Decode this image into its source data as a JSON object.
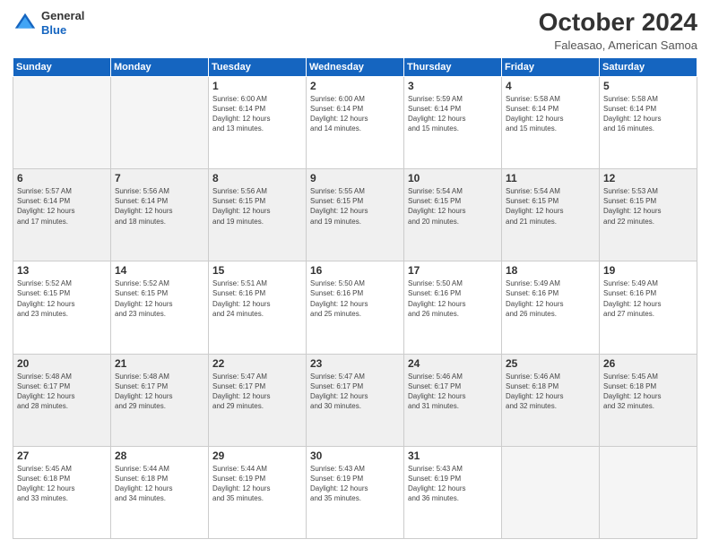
{
  "logo": {
    "general": "General",
    "blue": "Blue"
  },
  "header": {
    "title": "October 2024",
    "subtitle": "Faleasao, American Samoa"
  },
  "days_of_week": [
    "Sunday",
    "Monday",
    "Tuesday",
    "Wednesday",
    "Thursday",
    "Friday",
    "Saturday"
  ],
  "weeks": [
    [
      {
        "day": "",
        "info": ""
      },
      {
        "day": "",
        "info": ""
      },
      {
        "day": "1",
        "info": "Sunrise: 6:00 AM\nSunset: 6:14 PM\nDaylight: 12 hours\nand 13 minutes."
      },
      {
        "day": "2",
        "info": "Sunrise: 6:00 AM\nSunset: 6:14 PM\nDaylight: 12 hours\nand 14 minutes."
      },
      {
        "day": "3",
        "info": "Sunrise: 5:59 AM\nSunset: 6:14 PM\nDaylight: 12 hours\nand 15 minutes."
      },
      {
        "day": "4",
        "info": "Sunrise: 5:58 AM\nSunset: 6:14 PM\nDaylight: 12 hours\nand 15 minutes."
      },
      {
        "day": "5",
        "info": "Sunrise: 5:58 AM\nSunset: 6:14 PM\nDaylight: 12 hours\nand 16 minutes."
      }
    ],
    [
      {
        "day": "6",
        "info": "Sunrise: 5:57 AM\nSunset: 6:14 PM\nDaylight: 12 hours\nand 17 minutes."
      },
      {
        "day": "7",
        "info": "Sunrise: 5:56 AM\nSunset: 6:14 PM\nDaylight: 12 hours\nand 18 minutes."
      },
      {
        "day": "8",
        "info": "Sunrise: 5:56 AM\nSunset: 6:15 PM\nDaylight: 12 hours\nand 19 minutes."
      },
      {
        "day": "9",
        "info": "Sunrise: 5:55 AM\nSunset: 6:15 PM\nDaylight: 12 hours\nand 19 minutes."
      },
      {
        "day": "10",
        "info": "Sunrise: 5:54 AM\nSunset: 6:15 PM\nDaylight: 12 hours\nand 20 minutes."
      },
      {
        "day": "11",
        "info": "Sunrise: 5:54 AM\nSunset: 6:15 PM\nDaylight: 12 hours\nand 21 minutes."
      },
      {
        "day": "12",
        "info": "Sunrise: 5:53 AM\nSunset: 6:15 PM\nDaylight: 12 hours\nand 22 minutes."
      }
    ],
    [
      {
        "day": "13",
        "info": "Sunrise: 5:52 AM\nSunset: 6:15 PM\nDaylight: 12 hours\nand 23 minutes."
      },
      {
        "day": "14",
        "info": "Sunrise: 5:52 AM\nSunset: 6:15 PM\nDaylight: 12 hours\nand 23 minutes."
      },
      {
        "day": "15",
        "info": "Sunrise: 5:51 AM\nSunset: 6:16 PM\nDaylight: 12 hours\nand 24 minutes."
      },
      {
        "day": "16",
        "info": "Sunrise: 5:50 AM\nSunset: 6:16 PM\nDaylight: 12 hours\nand 25 minutes."
      },
      {
        "day": "17",
        "info": "Sunrise: 5:50 AM\nSunset: 6:16 PM\nDaylight: 12 hours\nand 26 minutes."
      },
      {
        "day": "18",
        "info": "Sunrise: 5:49 AM\nSunset: 6:16 PM\nDaylight: 12 hours\nand 26 minutes."
      },
      {
        "day": "19",
        "info": "Sunrise: 5:49 AM\nSunset: 6:16 PM\nDaylight: 12 hours\nand 27 minutes."
      }
    ],
    [
      {
        "day": "20",
        "info": "Sunrise: 5:48 AM\nSunset: 6:17 PM\nDaylight: 12 hours\nand 28 minutes."
      },
      {
        "day": "21",
        "info": "Sunrise: 5:48 AM\nSunset: 6:17 PM\nDaylight: 12 hours\nand 29 minutes."
      },
      {
        "day": "22",
        "info": "Sunrise: 5:47 AM\nSunset: 6:17 PM\nDaylight: 12 hours\nand 29 minutes."
      },
      {
        "day": "23",
        "info": "Sunrise: 5:47 AM\nSunset: 6:17 PM\nDaylight: 12 hours\nand 30 minutes."
      },
      {
        "day": "24",
        "info": "Sunrise: 5:46 AM\nSunset: 6:17 PM\nDaylight: 12 hours\nand 31 minutes."
      },
      {
        "day": "25",
        "info": "Sunrise: 5:46 AM\nSunset: 6:18 PM\nDaylight: 12 hours\nand 32 minutes."
      },
      {
        "day": "26",
        "info": "Sunrise: 5:45 AM\nSunset: 6:18 PM\nDaylight: 12 hours\nand 32 minutes."
      }
    ],
    [
      {
        "day": "27",
        "info": "Sunrise: 5:45 AM\nSunset: 6:18 PM\nDaylight: 12 hours\nand 33 minutes."
      },
      {
        "day": "28",
        "info": "Sunrise: 5:44 AM\nSunset: 6:18 PM\nDaylight: 12 hours\nand 34 minutes."
      },
      {
        "day": "29",
        "info": "Sunrise: 5:44 AM\nSunset: 6:19 PM\nDaylight: 12 hours\nand 35 minutes."
      },
      {
        "day": "30",
        "info": "Sunrise: 5:43 AM\nSunset: 6:19 PM\nDaylight: 12 hours\nand 35 minutes."
      },
      {
        "day": "31",
        "info": "Sunrise: 5:43 AM\nSunset: 6:19 PM\nDaylight: 12 hours\nand 36 minutes."
      },
      {
        "day": "",
        "info": ""
      },
      {
        "day": "",
        "info": ""
      }
    ]
  ]
}
